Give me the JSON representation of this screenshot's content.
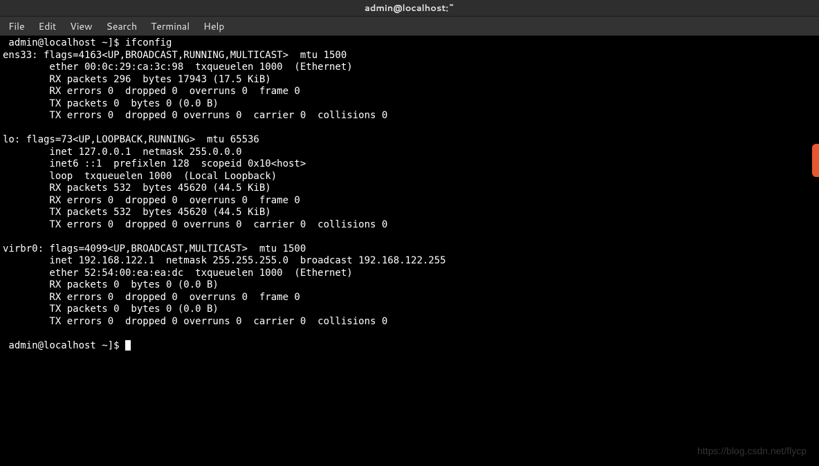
{
  "window": {
    "title": "admin@localhost:~"
  },
  "menu": {
    "file": "File",
    "edit": "Edit",
    "view": "View",
    "search": "Search",
    "terminal": "Terminal",
    "help": "Help"
  },
  "terminal": {
    "line01": " admin@localhost ~]$ ifconfig",
    "line02": "ens33: flags=4163<UP,BROADCAST,RUNNING,MULTICAST>  mtu 1500",
    "line03": "        ether 00:0c:29:ca:3c:98  txqueuelen 1000  (Ethernet)",
    "line04": "        RX packets 296  bytes 17943 (17.5 KiB)",
    "line05": "        RX errors 0  dropped 0  overruns 0  frame 0",
    "line06": "        TX packets 0  bytes 0 (0.0 B)",
    "line07": "        TX errors 0  dropped 0 overruns 0  carrier 0  collisions 0",
    "line08": "",
    "line09": "lo: flags=73<UP,LOOPBACK,RUNNING>  mtu 65536",
    "line10": "        inet 127.0.0.1  netmask 255.0.0.0",
    "line11": "        inet6 ::1  prefixlen 128  scopeid 0x10<host>",
    "line12": "        loop  txqueuelen 1000  (Local Loopback)",
    "line13": "        RX packets 532  bytes 45620 (44.5 KiB)",
    "line14": "        RX errors 0  dropped 0  overruns 0  frame 0",
    "line15": "        TX packets 532  bytes 45620 (44.5 KiB)",
    "line16": "        TX errors 0  dropped 0 overruns 0  carrier 0  collisions 0",
    "line17": "",
    "line18": "virbr0: flags=4099<UP,BROADCAST,MULTICAST>  mtu 1500",
    "line19": "        inet 192.168.122.1  netmask 255.255.255.0  broadcast 192.168.122.255",
    "line20": "        ether 52:54:00:ea:ea:dc  txqueuelen 1000  (Ethernet)",
    "line21": "        RX packets 0  bytes 0 (0.0 B)",
    "line22": "        RX errors 0  dropped 0  overruns 0  frame 0",
    "line23": "        TX packets 0  bytes 0 (0.0 B)",
    "line24": "        TX errors 0  dropped 0 overruns 0  carrier 0  collisions 0",
    "line25": "",
    "prompt": " admin@localhost ~]$ "
  },
  "watermark": "https://blog.csdn.net/flycp"
}
